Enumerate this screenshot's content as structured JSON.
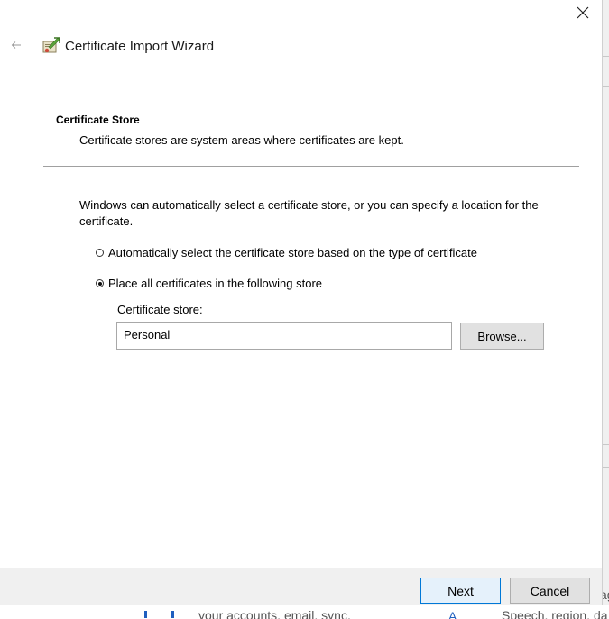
{
  "window": {
    "title": "Certificate Import Wizard",
    "back_icon": "back-arrow-icon",
    "close_icon": "close-icon",
    "wizard_icon": "certificate-wizard-icon"
  },
  "section": {
    "title": "Certificate Store",
    "subtitle": "Certificate stores are system areas where certificates are kept."
  },
  "description": "Windows can automatically select a certificate store, or you can specify a location for the certificate.",
  "options": [
    {
      "label": "Automatically select the certificate store based on the type of certificate",
      "checked": false
    },
    {
      "label": "Place all certificates in the following store",
      "checked": true
    }
  ],
  "store": {
    "label": "Certificate store:",
    "value": "Personal",
    "browse_label": "Browse..."
  },
  "footer": {
    "next_label": "Next",
    "cancel_label": "Cancel"
  },
  "background": {
    "text_left": "your accounts, email, sync,",
    "text_right": "Speech, region, da",
    "text_edge": "ag"
  },
  "colors": {
    "accent": "#0078d7",
    "footer_bg": "#f0f0f0",
    "button_bg": "#e1e1e1"
  }
}
